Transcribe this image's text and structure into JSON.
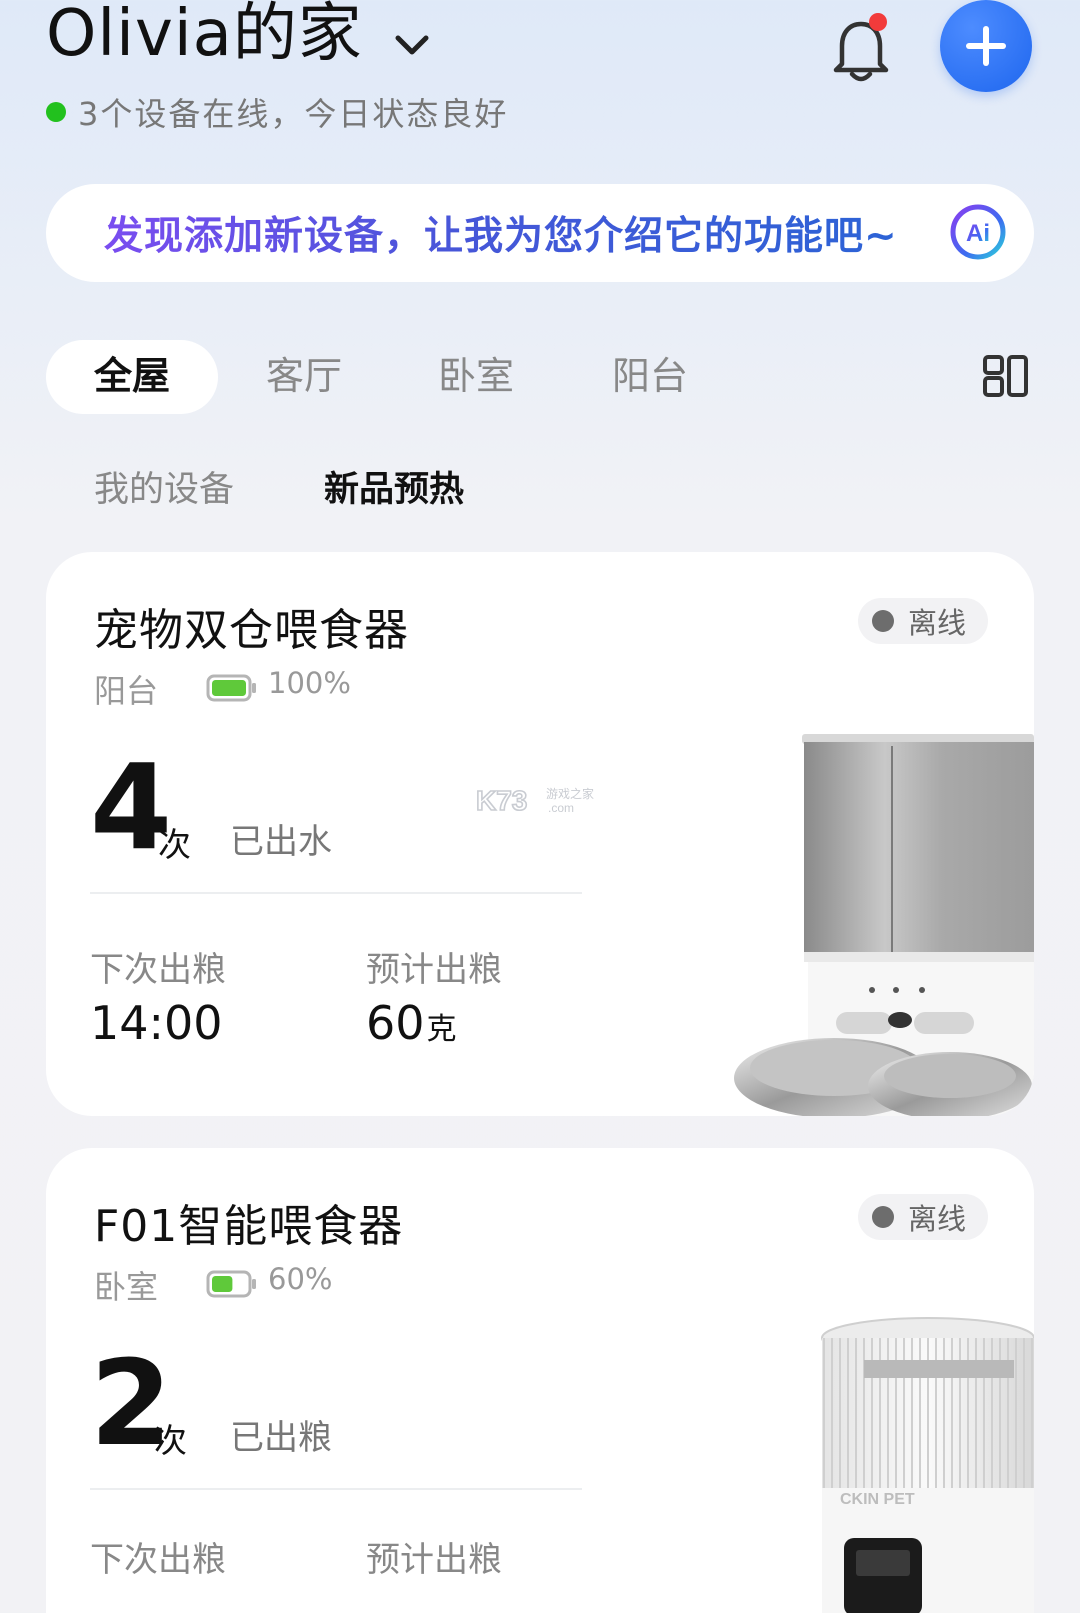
{
  "header": {
    "home_title": "Olivia的家",
    "status": "3个设备在线，今日状态良好"
  },
  "ai_banner": {
    "text": "发现添加新设备，让我为您介绍它的功能吧~"
  },
  "room_tabs": [
    {
      "label": "全屋",
      "active": true
    },
    {
      "label": "客厅",
      "active": false
    },
    {
      "label": "卧室",
      "active": false
    },
    {
      "label": "阳台",
      "active": false
    }
  ],
  "sub_tabs": [
    {
      "label": "我的设备",
      "active": false
    },
    {
      "label": "新品预热",
      "active": true
    }
  ],
  "devices": [
    {
      "name": "宠物双仓喂食器",
      "status": "离线",
      "room": "阳台",
      "battery": "100%",
      "battery_level": 1.0,
      "count": "4",
      "count_unit": "次",
      "count_desc": "已出水",
      "next_label": "下次出粮",
      "next_value": "14:00",
      "amount_label": "预计出粮",
      "amount_value": "60",
      "amount_unit": "克"
    },
    {
      "name": "F01智能喂食器",
      "status": "离线",
      "room": "卧室",
      "battery": "60%",
      "battery_level": 0.6,
      "count": "2",
      "count_unit": "次",
      "count_desc": "已出粮",
      "next_label": "下次出粮",
      "next_value": "",
      "amount_label": "预计出粮",
      "amount_value": "",
      "amount_unit": ""
    }
  ],
  "watermark_text": "K73 游戏之家 .com",
  "product_label": "CKIN PET",
  "colors": {
    "accent_blue": "#1e66ee",
    "online_green": "#22c11e",
    "battery_green": "#5fc93a",
    "notification_red": "#f23b3b",
    "offline_gray": "#6d6d6d"
  }
}
